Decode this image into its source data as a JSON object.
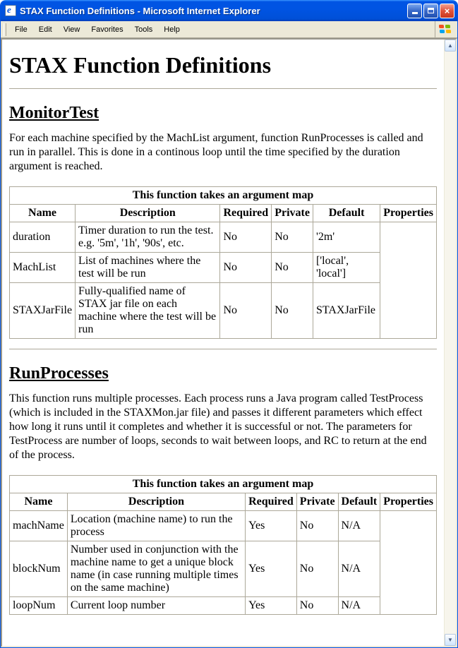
{
  "window": {
    "title": "STAX Function Definitions - Microsoft Internet Explorer"
  },
  "menubar": [
    "File",
    "Edit",
    "View",
    "Favorites",
    "Tools",
    "Help"
  ],
  "page": {
    "title": "STAX Function Definitions",
    "sections": [
      {
        "heading": "MonitorTest",
        "description": "For each machine specified by the MachList argument, function RunProcesses is called and run in parallel. This is done in a continous loop until the time specified by the duration argument is reached.",
        "table_caption": "This function takes an argument map",
        "columns": [
          "Name",
          "Description",
          "Required",
          "Private",
          "Default",
          "Properties"
        ],
        "rows": [
          {
            "name": "duration",
            "description": "Timer duration to run the test. e.g. '5m', '1h', '90s', etc.",
            "required": "No",
            "private": "No",
            "default": "'2m'"
          },
          {
            "name": "MachList",
            "description": "List of machines where the test will be run",
            "required": "No",
            "private": "No",
            "default": "['local', 'local']"
          },
          {
            "name": "STAXJarFile",
            "description": "Fully-qualified name of STAX jar file on each machine where the test will be run",
            "required": "No",
            "private": "No",
            "default": "STAXJarFile"
          }
        ]
      },
      {
        "heading": "RunProcesses",
        "description": "This function runs multiple processes. Each process runs a Java program called TestProcess (which is included in the STAXMon.jar file) and passes it different parameters which effect how long it runs until it completes and whether it is successful or not. The parameters for TestProcess are number of loops, seconds to wait between loops, and RC to return at the end of the process.",
        "table_caption": "This function takes an argument map",
        "columns": [
          "Name",
          "Description",
          "Required",
          "Private",
          "Default",
          "Properties"
        ],
        "rows": [
          {
            "name": "machName",
            "description": "Location (machine name) to run the process",
            "required": "Yes",
            "private": "No",
            "default": "N/A"
          },
          {
            "name": "blockNum",
            "description": "Number used in conjunction with the machine name to get a unique block name (in case running multiple times on the same machine)",
            "required": "Yes",
            "private": "No",
            "default": "N/A"
          },
          {
            "name": "loopNum",
            "description": "Current loop number",
            "required": "Yes",
            "private": "No",
            "default": "N/A"
          }
        ]
      }
    ]
  }
}
